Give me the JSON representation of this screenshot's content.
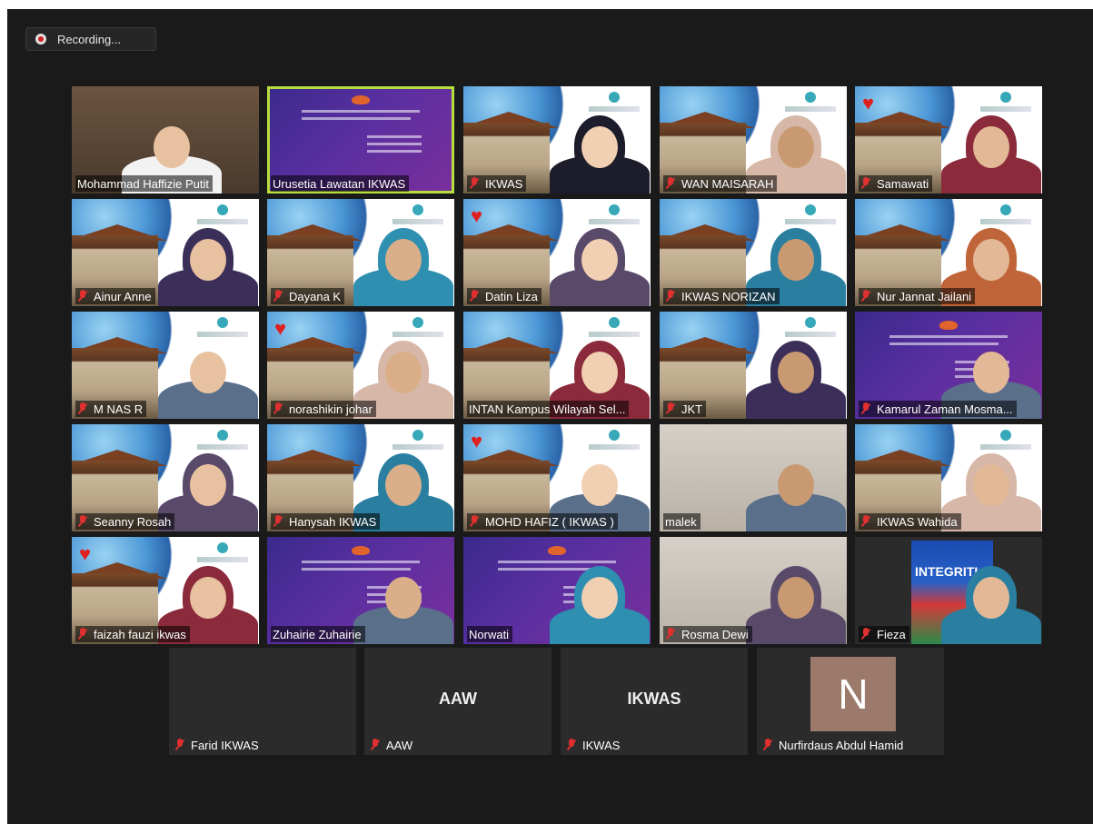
{
  "recording": {
    "label": "Recording..."
  },
  "participants": [
    {
      "name": "Mohammad Haffizie Putit",
      "muted": false,
      "heart": false,
      "bg": "room",
      "active": false
    },
    {
      "name": "Urusetia Lawatan IKWAS",
      "muted": false,
      "heart": false,
      "bg": "purple",
      "active": true
    },
    {
      "name": "IKWAS",
      "muted": true,
      "heart": false,
      "bg": "campus",
      "active": false
    },
    {
      "name": "WAN MAISARAH",
      "muted": true,
      "heart": false,
      "bg": "campus",
      "active": false
    },
    {
      "name": "Samawati",
      "muted": true,
      "heart": true,
      "bg": "campus",
      "active": false
    },
    {
      "name": "Ainur Anne",
      "muted": true,
      "heart": false,
      "bg": "campus",
      "active": false
    },
    {
      "name": "Dayana K",
      "muted": true,
      "heart": false,
      "bg": "campus",
      "active": false
    },
    {
      "name": "Datin Liza",
      "muted": true,
      "heart": true,
      "bg": "campus",
      "active": false
    },
    {
      "name": "IKWAS NORIZAN",
      "muted": true,
      "heart": false,
      "bg": "campus",
      "active": false
    },
    {
      "name": "Nur Jannat Jailani",
      "muted": true,
      "heart": false,
      "bg": "campus",
      "active": false
    },
    {
      "name": "M NAS R",
      "muted": true,
      "heart": false,
      "bg": "campus",
      "active": false
    },
    {
      "name": "norashikin johar",
      "muted": true,
      "heart": true,
      "bg": "campus",
      "active": false
    },
    {
      "name": "INTAN Kampus Wilayah Sel...",
      "muted": false,
      "heart": false,
      "bg": "campus",
      "active": false
    },
    {
      "name": "JKT",
      "muted": true,
      "heart": false,
      "bg": "campus",
      "active": false
    },
    {
      "name": "Kamarul Zaman Mosma...",
      "muted": true,
      "heart": false,
      "bg": "purple",
      "active": false
    },
    {
      "name": "Seanny Rosah",
      "muted": true,
      "heart": false,
      "bg": "campus",
      "active": false
    },
    {
      "name": "Hanysah IKWAS",
      "muted": true,
      "heart": false,
      "bg": "campus",
      "active": false
    },
    {
      "name": "MOHD HAFIZ ( IKWAS )",
      "muted": true,
      "heart": true,
      "bg": "campus",
      "active": false
    },
    {
      "name": "malek",
      "muted": false,
      "heart": false,
      "bg": "wall",
      "active": false
    },
    {
      "name": "IKWAS Wahida",
      "muted": true,
      "heart": false,
      "bg": "campus",
      "active": false
    },
    {
      "name": "faizah fauzi ikwas",
      "muted": true,
      "heart": true,
      "bg": "campus",
      "active": false
    },
    {
      "name": "Zuhairie Zuhairie",
      "muted": false,
      "heart": false,
      "bg": "purple",
      "active": false
    },
    {
      "name": "Norwati",
      "muted": false,
      "heart": false,
      "bg": "purple",
      "active": false
    },
    {
      "name": "Rosma Dewi",
      "muted": true,
      "heart": false,
      "bg": "wall",
      "active": false
    },
    {
      "name": "Fieza",
      "muted": true,
      "heart": false,
      "bg": "poster",
      "active": false,
      "poster_text": "INTEGRITI"
    }
  ],
  "bottom_row": [
    {
      "name": "Farid IKWAS",
      "muted": true,
      "display": ""
    },
    {
      "name": "AAW",
      "muted": true,
      "display": "AAW"
    },
    {
      "name": "IKWAS",
      "muted": true,
      "display": "IKWAS"
    },
    {
      "name": "Nurfirdaus Abdul Hamid",
      "muted": true,
      "display": "",
      "avatar_letter": "N",
      "avatar_color": "#9b7a6c"
    }
  ],
  "colors": {
    "active_border": "#b7de3c",
    "muted_icon": "#e03030",
    "heart": "#e02020"
  }
}
